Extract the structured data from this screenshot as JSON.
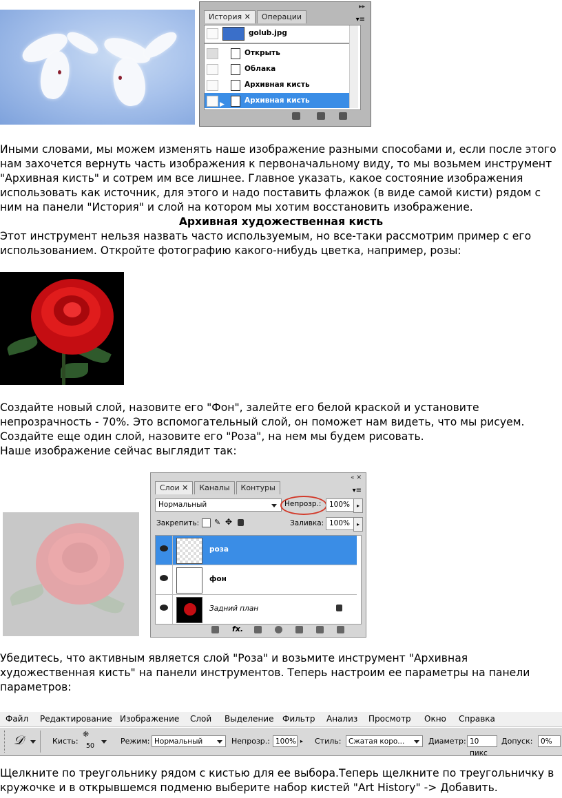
{
  "history_panel": {
    "tabs": [
      "История ✕",
      "Операции"
    ],
    "snapshot": "golub.jpg",
    "items": [
      "Открыть",
      "Облака",
      "Архивная кисть",
      "Архивная кисть"
    ]
  },
  "para1": [
    "Иными словами, мы можем изменять наше изображение разными способами и, если после этого",
    "нам захочется вернуть часть изображения к первоначальному виду, то мы возьмем инструмент",
    "\"Архивная кисть\" и сотрем им все лишнее. Главное указать, какое состояние изображения",
    "использовать как источник, для этого и надо поставить флажок (в виде самой кисти) рядом с",
    "ним на панели \"История\" и слой на котором мы хотим восстановить изображение."
  ],
  "heading": "Архивная художественная кисть",
  "para2": [
    "Этот инструмент нельзя назвать часто используемым, но все-таки рассмотрим пример с его",
    "использованием. Откройте фотографию какого-нибудь цветка, например, розы:"
  ],
  "para3": [
    "Создайте новый слой, назовите его \"Фон\", залейте его белой краской и установите",
    "непрозрачность - 70%. Это вспомогательный слой, он поможет нам видеть, что мы рисуем.",
    "Создайте еще один слой, назовите его \"Роза\", на нем мы будем рисовать.",
    "Наше изображение сейчас выглядит так:"
  ],
  "layers_panel": {
    "tabs": [
      "Слои ✕",
      "Каналы",
      "Контуры"
    ],
    "blend_mode": "Нормальный",
    "opacity_label": "Непрозр.:",
    "opacity_value": "100%",
    "lock_label": "Закрепить:",
    "fill_label": "Заливка:",
    "fill_value": "100%",
    "layers": [
      "роза",
      "фон",
      "Задний план"
    ],
    "footer_icons": [
      "link-icon",
      "fx-icon",
      "mask-icon",
      "adjustment-icon",
      "group-icon",
      "new-layer-icon",
      "trash-icon"
    ]
  },
  "para4": [
    "Убедитесь, что активным является слой \"Роза\" и возьмите инструмент \"Архивная",
    "художественная кисть\" на панели инструментов. Теперь настроим ее параметры на панели",
    "параметров:"
  ],
  "menu": [
    "Файл",
    "Редактирование",
    "Изображение",
    "Слой",
    "Выделение",
    "Фильтр",
    "Анализ",
    "Просмотр",
    "Окно",
    "Справка"
  ],
  "options_bar": {
    "brush_label": "Кисть:",
    "brush_size": "50",
    "mode_label": "Режим:",
    "mode_value": "Нормальный",
    "opacity_label": "Непрозр.:",
    "opacity_value": "100%",
    "style_label": "Стиль:",
    "style_value": "Сжатая коро...",
    "diameter_label": "Диаметр:",
    "diameter_value": "10 пикс",
    "tolerance_label": "Допуск:",
    "tolerance_value": "0%"
  },
  "para5": [
    "Щелкните по треугольнику рядом с кистью для ее выбора.Теперь щелкните по треугольничку в",
    "кружочке и в открывшемся подменю выберите набор кистей \"Art History\" -> Добавить."
  ]
}
